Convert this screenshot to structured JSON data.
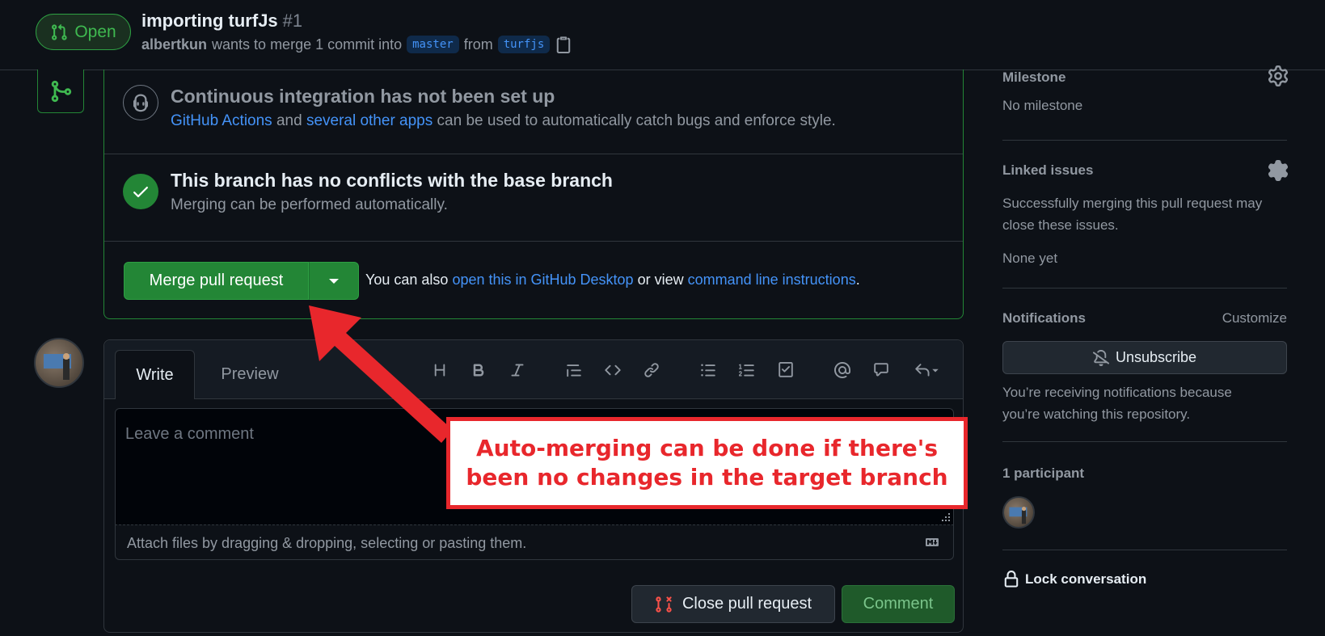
{
  "header": {
    "status_badge": "Open",
    "title": "importing turfJs",
    "number": "#1",
    "author": "albertkun",
    "merge_text": "wants to merge 1 commit into",
    "base_branch": "master",
    "from_text": "from",
    "head_branch": "turfjs"
  },
  "merge_box": {
    "ci_title": "Continuous integration has not been set up",
    "ci_link1": "GitHub Actions",
    "ci_and": "and",
    "ci_link2": "several other apps",
    "ci_rest": "can be used to automatically catch bugs and enforce style.",
    "conflict_title": "This branch has no conflicts with the base branch",
    "conflict_desc": "Merging can be performed automatically.",
    "merge_button": "Merge pull request",
    "hint_prefix": "You can also",
    "hint_link1": "open this in GitHub Desktop",
    "hint_mid": "or view",
    "hint_link2": "command line instructions",
    "hint_suffix": "."
  },
  "editor": {
    "tab_write": "Write",
    "tab_preview": "Preview",
    "placeholder": "Leave a comment",
    "attach_text": "Attach files by dragging & dropping, selecting or pasting them.",
    "close_button": "Close pull request",
    "comment_button": "Comment"
  },
  "sidebar": {
    "milestone_head": "Milestone",
    "milestone_value": "No milestone",
    "linked_head": "Linked issues",
    "linked_desc": "Successfully merging this pull request may close these issues.",
    "linked_value": "None yet",
    "notif_head": "Notifications",
    "notif_customize": "Customize",
    "unsubscribe": "Unsubscribe",
    "notif_desc": "You’re receiving notifications because you’re watching this repository.",
    "participants": "1 participant",
    "lock": "Lock conversation"
  },
  "annotation": {
    "text": "Auto-merging can be done if there's been no changes in the target branch"
  },
  "colors": {
    "background": "#0d1117",
    "accent_green": "#238636",
    "link_blue": "#4493f8",
    "annotation_red": "#e8272c"
  }
}
